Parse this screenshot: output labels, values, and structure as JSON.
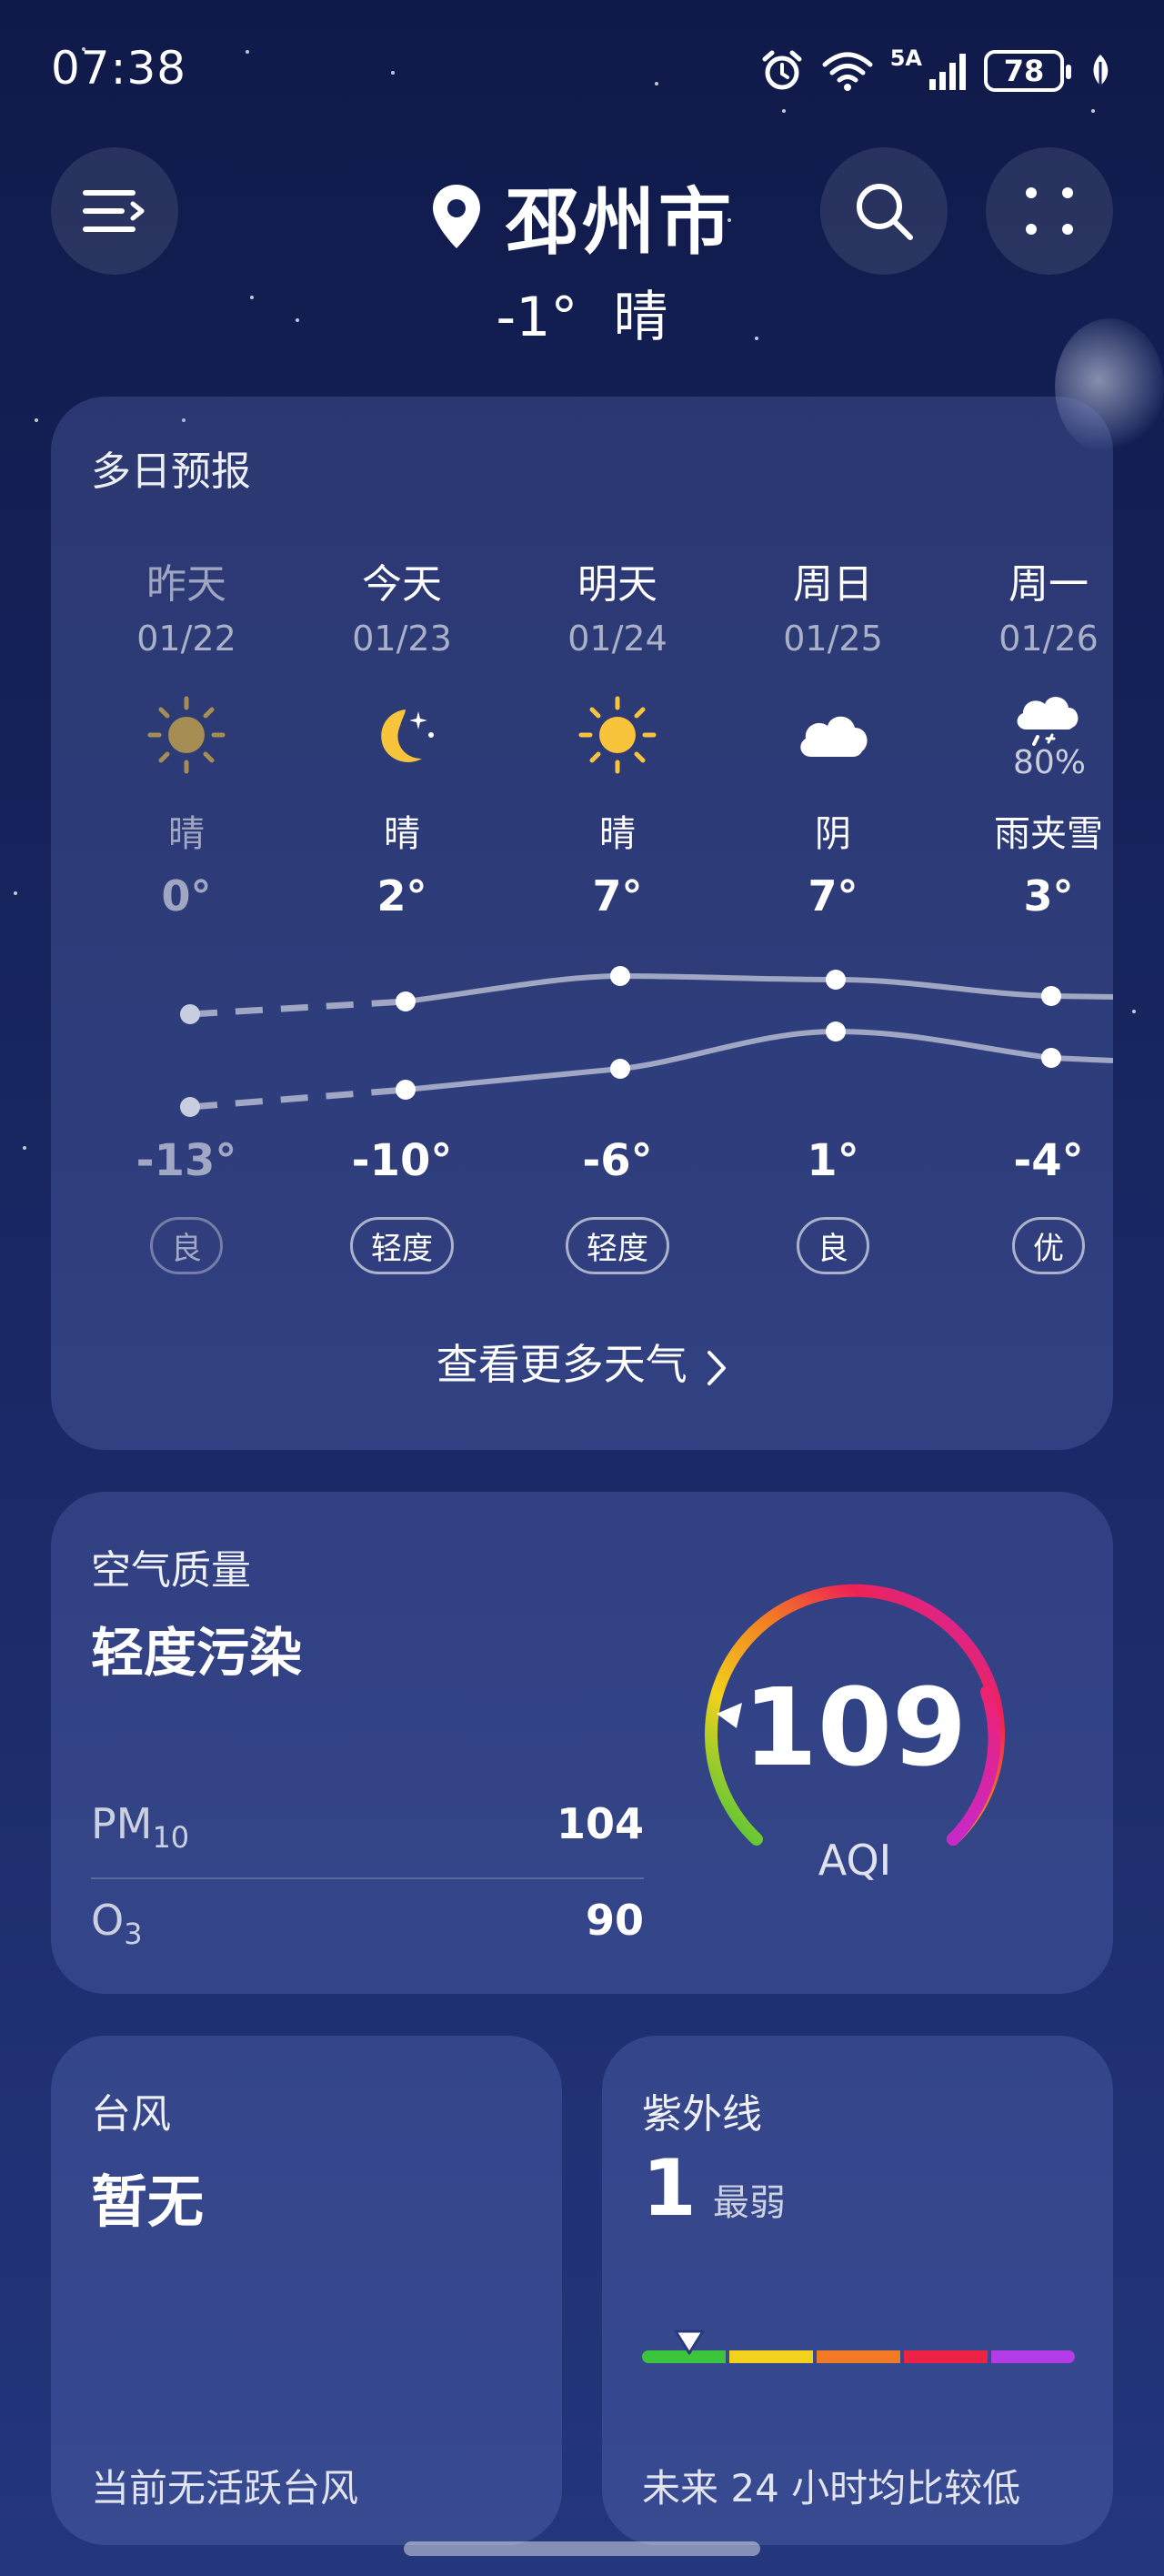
{
  "status_bar": {
    "time": "07:38",
    "network_label": "5A",
    "battery": "78"
  },
  "header": {
    "city": "邳州市",
    "current_temp": "-1°",
    "current_condition": "晴"
  },
  "forecast": {
    "title": "多日预报",
    "days": [
      {
        "name": "昨天",
        "date": "01/22",
        "icon": "sun-icon",
        "condition": "晴",
        "high": "0°",
        "low": "-13°",
        "aqi": "良",
        "precip": ""
      },
      {
        "name": "今天",
        "date": "01/23",
        "icon": "moon-icon",
        "condition": "晴",
        "high": "2°",
        "low": "-10°",
        "aqi": "轻度",
        "precip": ""
      },
      {
        "name": "明天",
        "date": "01/24",
        "icon": "sun-icon",
        "condition": "晴",
        "high": "7°",
        "low": "-6°",
        "aqi": "轻度",
        "precip": ""
      },
      {
        "name": "周日",
        "date": "01/25",
        "icon": "cloud-icon",
        "condition": "阴",
        "high": "7°",
        "low": "1°",
        "aqi": "良",
        "precip": ""
      },
      {
        "name": "周一",
        "date": "01/26",
        "icon": "sleet-icon",
        "condition": "雨夹雪",
        "high": "3°",
        "low": "-4°",
        "aqi": "优",
        "precip": "80%"
      }
    ],
    "more_link": "查看更多天气"
  },
  "air_quality": {
    "title": "空气质量",
    "level": "轻度污染",
    "aqi_value": "109",
    "aqi_label": "AQI",
    "pollutants": [
      {
        "name": "PM",
        "sub": "10",
        "value": "104"
      },
      {
        "name": "O",
        "sub": "3",
        "value": "90"
      }
    ]
  },
  "typhoon": {
    "title": "台风",
    "value": "暂无",
    "footer": "当前无活跃台风"
  },
  "uv": {
    "title": "紫外线",
    "index": "1",
    "level": "最弱",
    "footer": "未来 24 小时均比较低",
    "scale_colors": [
      "#3cc43c",
      "#f2d21c",
      "#f27a24",
      "#ee2244",
      "#b43ce8"
    ]
  }
}
